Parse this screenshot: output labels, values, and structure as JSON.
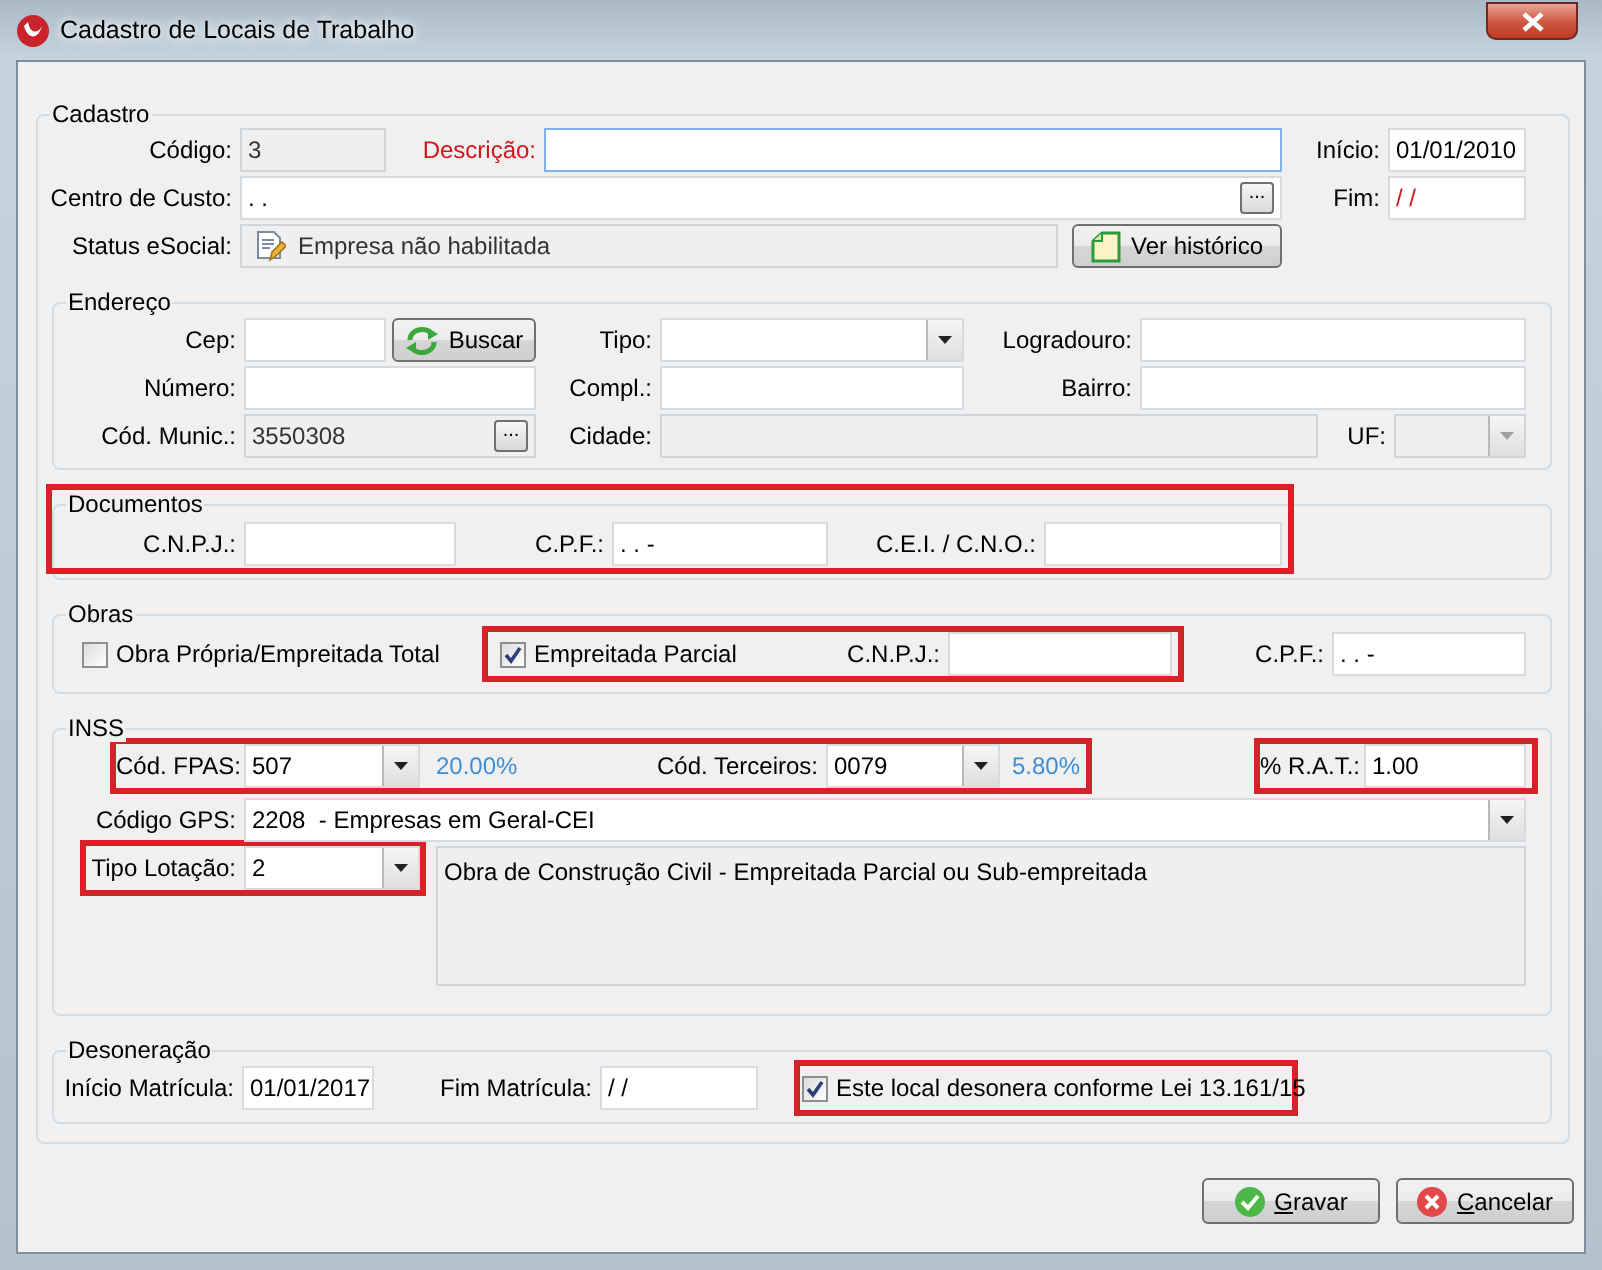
{
  "window": {
    "title": "Cadastro de Locais de Trabalho"
  },
  "cadastro": {
    "legend": "Cadastro",
    "codigo": {
      "label": "Código:",
      "value": "3",
      "disabled": true
    },
    "descricao": {
      "label": "Descrição:",
      "required": true
    },
    "inicio": {
      "label": "Início:",
      "value": "01/01/2010"
    },
    "centro_custo": {
      "label": "Centro de Custo:",
      "value": ". .",
      "button": "..."
    },
    "fim": {
      "label": "Fim:",
      "value": "/ /",
      "invalid": true
    },
    "status_esocial": {
      "label": "Status eSocial:",
      "value": "Empresa não habilitada",
      "disabled": true
    },
    "ver_historico_button": "Ver histórico"
  },
  "endereco": {
    "legend": "Endereço",
    "cep": {
      "label": "Cep:"
    },
    "buscar_button": "Buscar",
    "tipo": {
      "label": "Tipo:"
    },
    "logradouro": {
      "label": "Logradouro:"
    },
    "numero": {
      "label": "Número:"
    },
    "compl": {
      "label": "Compl.:"
    },
    "bairro": {
      "label": "Bairro:"
    },
    "cod_munic": {
      "label": "Cód. Munic.:",
      "value": "3550308",
      "button": "...",
      "disabled": true
    },
    "cidade": {
      "label": "Cidade:",
      "disabled": true
    },
    "uf": {
      "label": "UF:",
      "disabled": true
    }
  },
  "documentos": {
    "legend": "Documentos",
    "highlighted": true,
    "cnpj": {
      "label": "C.N.P.J.:"
    },
    "cpf": {
      "label": "C.P.F.:",
      "value": ". . -"
    },
    "cei_cno": {
      "label": "C.E.I. / C.N.O.:"
    }
  },
  "obras": {
    "legend": "Obras",
    "obra_propria": {
      "label": "Obra Própria/Empreitada Total",
      "checked": false
    },
    "parcial": {
      "highlighted": true,
      "checkbox": {
        "label": "Empreitada Parcial",
        "checked": true
      },
      "cnpj": {
        "label": "C.N.P.J.:"
      }
    },
    "cpf": {
      "label": "C.P.F.:",
      "value": ". . -"
    }
  },
  "inss": {
    "legend": "INSS",
    "contribuicoes": {
      "highlighted": true,
      "fpas": {
        "label": "Cód. FPAS:",
        "value": "507",
        "rate": "20.00%"
      },
      "terceiros": {
        "label": "Cód. Terceiros:",
        "value": "0079",
        "rate": "5.80%"
      }
    },
    "rat": {
      "highlighted": true,
      "label": "% R.A.T.:",
      "value": "1.00"
    },
    "codigo_gps": {
      "label": "Código GPS:",
      "value": "2208  - Empresas em Geral-CEI"
    },
    "tipo_lotacao": {
      "highlighted": true,
      "label": "Tipo Lotação:",
      "value": "2"
    },
    "lotacao_descricao": "Obra de Construção Civil - Empreitada Parcial ou Sub-empreitada"
  },
  "desoneracao": {
    "legend": "Desoneração",
    "inicio_matricula": {
      "label": "Início Matrícula:",
      "value": "01/01/2017"
    },
    "fim_matricula": {
      "label": "Fim Matrícula:",
      "value": "/ /"
    },
    "desonera": {
      "highlighted": true,
      "label": "Este local desonera conforme Lei 13.161/15",
      "checked": true
    }
  },
  "buttons": [
    {
      "kind": "confirm",
      "label": "Gravar"
    },
    {
      "kind": "cancel",
      "label": "Cancelar"
    }
  ]
}
